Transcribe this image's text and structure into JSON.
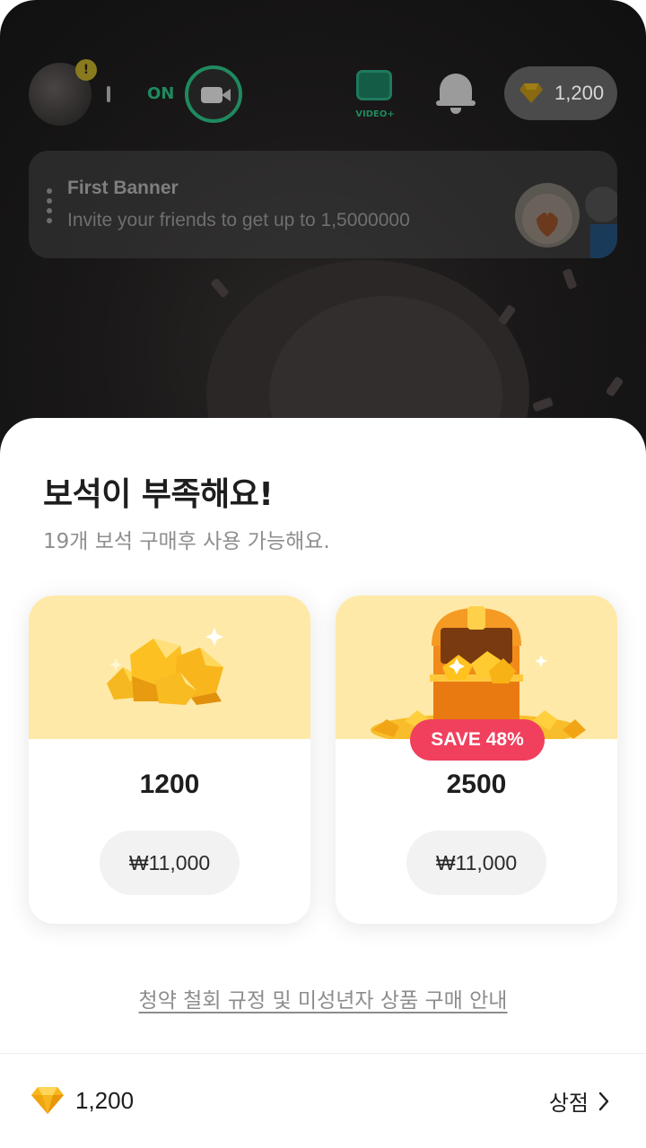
{
  "header": {
    "alert_badge": "!",
    "on_label": "ON",
    "video_plus_label": "VIDEO+",
    "gem_count": "1,200"
  },
  "banner": {
    "title": "First Banner",
    "subtitle": "Invite your friends to get up to 1,5000000"
  },
  "sheet": {
    "title": "보석이 부족해요!",
    "subtitle": "19개 보석 구매후 사용 가능해요.",
    "packages": [
      {
        "amount": "1200",
        "price": "₩11,000"
      },
      {
        "amount": "2500",
        "price": "₩11,000",
        "badge": "SAVE 48%"
      }
    ],
    "notice_link": "청약 철회 규정 및 미성년자 상품 구매 안내",
    "footer": {
      "gem_count": "1,200",
      "store_label": "상점"
    }
  },
  "colors": {
    "accent_green": "#1f8a5f",
    "card_top_yellow": "#ffe9a8",
    "gem_gold": "#f7b51e",
    "badge_red": "#f0405e"
  },
  "icons": [
    "camera-icon",
    "video-plus-icon",
    "bell-icon",
    "gem-icon",
    "chevron-right-icon",
    "gem-pile-icon",
    "treasure-chest-icon"
  ]
}
